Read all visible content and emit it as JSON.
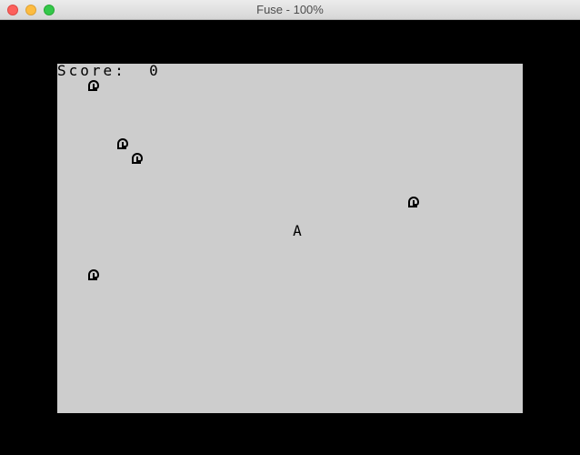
{
  "window": {
    "title": "Fuse - 100%"
  },
  "game": {
    "score_text": "Score:  0",
    "player_glyph": "A"
  }
}
